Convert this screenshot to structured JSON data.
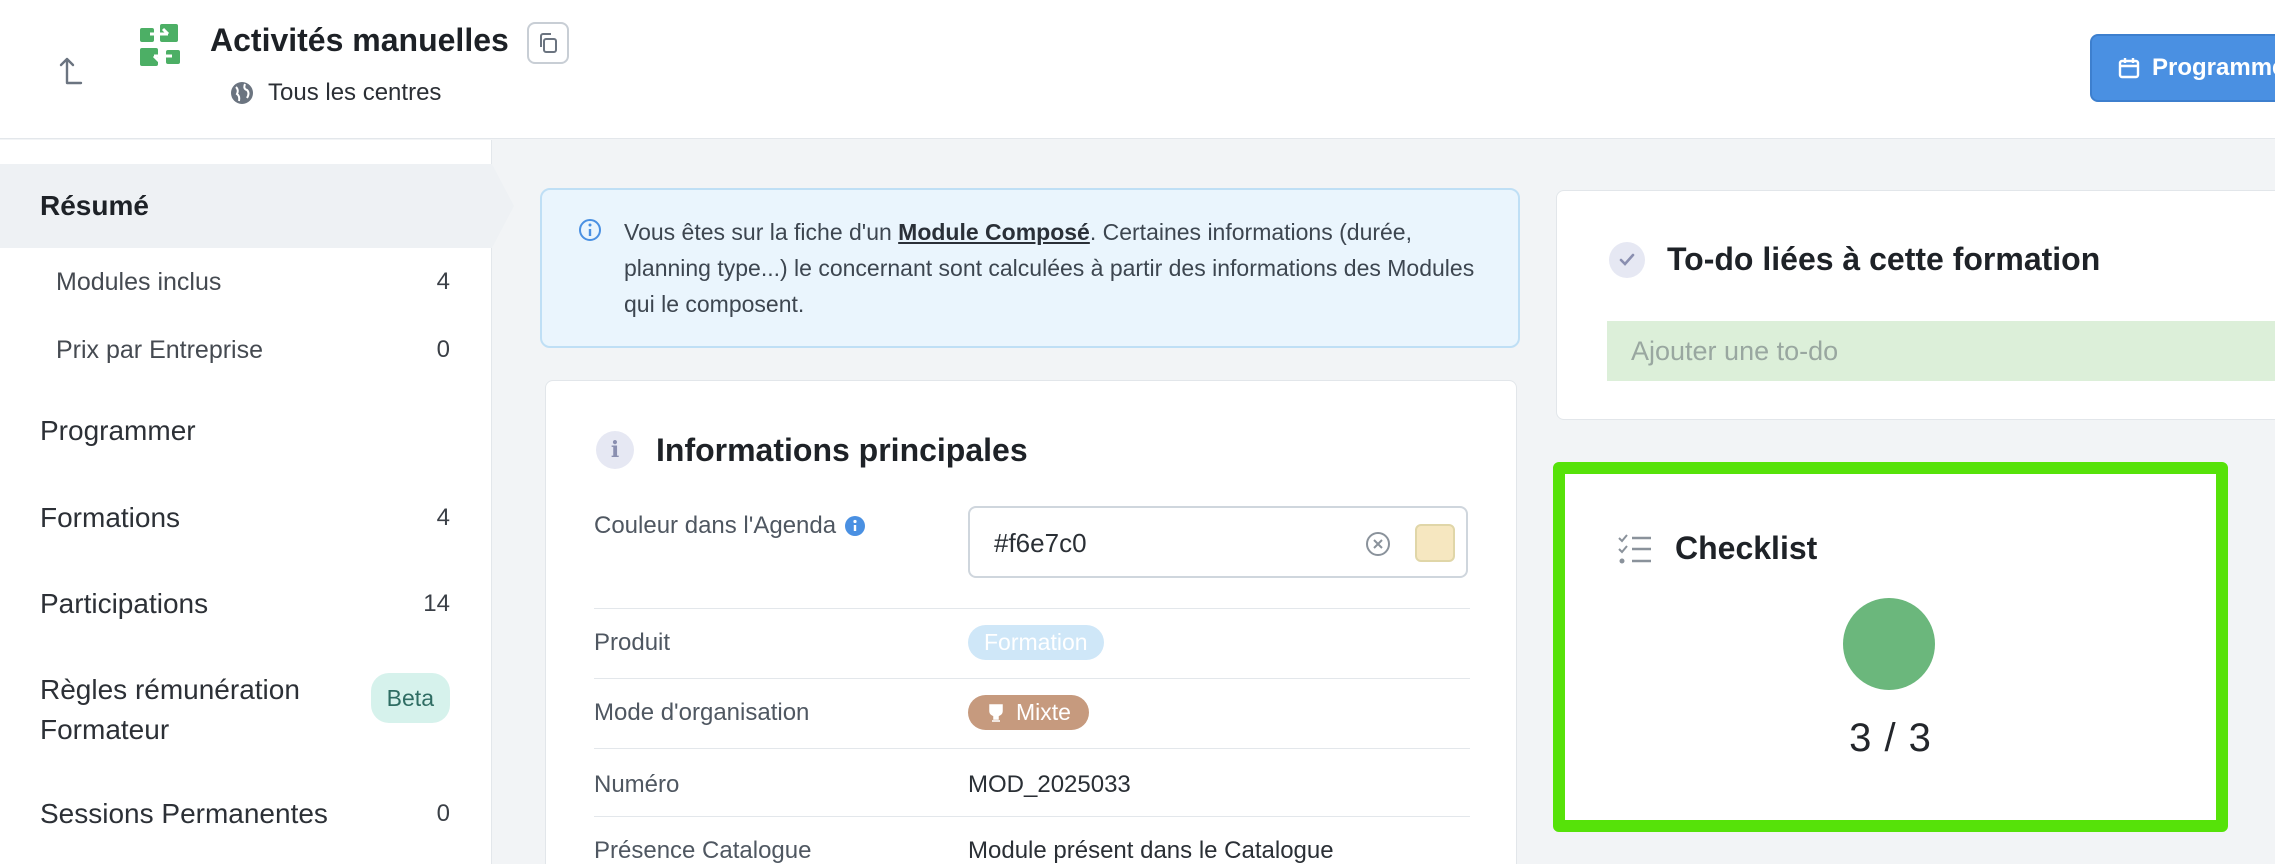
{
  "header": {
    "title": "Activités manuelles",
    "scope": "Tous les centres",
    "program_button": "Programme"
  },
  "sidebar": {
    "items": [
      {
        "label": "Résumé",
        "count": ""
      },
      {
        "label": "Modules inclus",
        "count": "4"
      },
      {
        "label": "Prix par Entreprise",
        "count": "0"
      },
      {
        "label": "Programmer",
        "count": ""
      },
      {
        "label": "Formations",
        "count": "4"
      },
      {
        "label": "Participations",
        "count": "14"
      },
      {
        "label": "Règles rémunération Formateur",
        "count": "",
        "badge": "Beta"
      },
      {
        "label": "Sessions Permanentes",
        "count": "0"
      }
    ]
  },
  "banner": {
    "before": "Vous êtes sur la fiche d'un ",
    "link": "Module Composé",
    "after": ". Certaines informations (durée, planning type...) le concernant sont calculées à partir des informations des Modules qui le composent."
  },
  "main_info": {
    "title": "Informations principales",
    "rows": [
      {
        "key": "Couleur dans l'Agenda",
        "value": "#f6e7c0"
      },
      {
        "key": "Produit",
        "value": "Formation"
      },
      {
        "key": "Mode d'organisation",
        "value": "Mixte"
      },
      {
        "key": "Numéro",
        "value": "MOD_2025033"
      },
      {
        "key": "Présence Catalogue",
        "value": "Module présent dans le Catalogue"
      }
    ]
  },
  "todo": {
    "title": "To-do liées à cette formation",
    "placeholder": "Ajouter une to-do"
  },
  "checklist": {
    "title": "Checklist",
    "ratio": "3 / 3"
  },
  "colors": {
    "accent": "#4a90e2",
    "swatch": "#f6e7c0",
    "highlight": "#56e209",
    "checklist_done": "#6bb77c"
  }
}
